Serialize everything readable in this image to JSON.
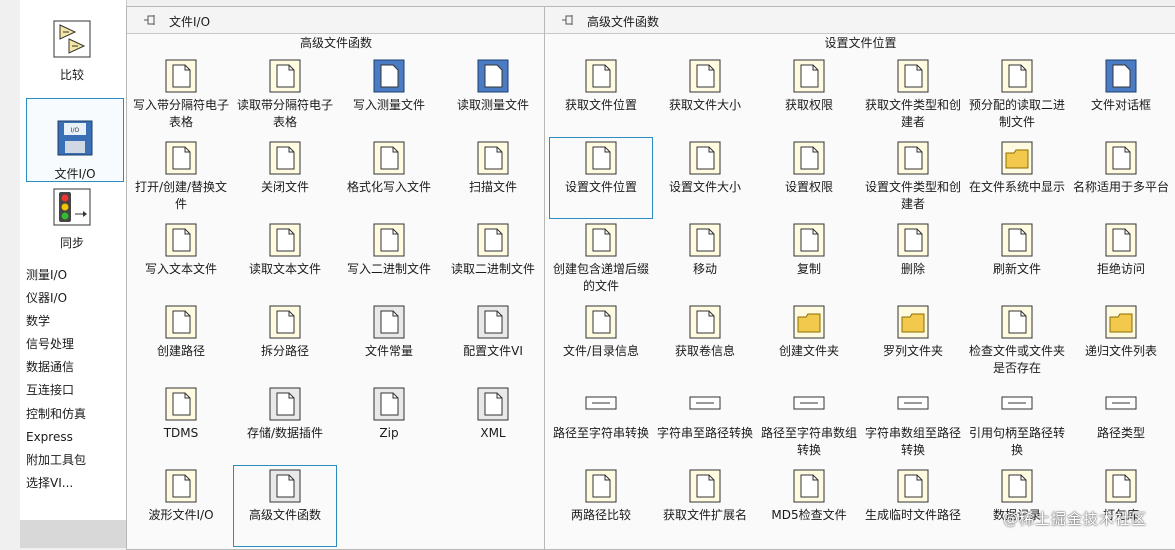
{
  "left": {
    "compare_label": "比较",
    "file_io_label": "文件I/O",
    "sync_label": "同步",
    "list": [
      "测量I/O",
      "仪器I/O",
      "数学",
      "信号处理",
      "数据通信",
      "互连接口",
      "控制和仿真",
      "Express",
      "附加工具包",
      "选择VI..."
    ]
  },
  "panel1": {
    "title": "文件I/O",
    "subtitle": "高级文件函数",
    "items": [
      {
        "label": "写入带分隔符电子表格",
        "icon": "spreadsheet-write-icon"
      },
      {
        "label": "读取带分隔符电子表格",
        "icon": "spreadsheet-read-icon"
      },
      {
        "label": "写入测量文件",
        "icon": "write-measurement-file-icon"
      },
      {
        "label": "读取测量文件",
        "icon": "read-measurement-file-icon"
      },
      {
        "label": "打开/创建/替换文件",
        "icon": "open-file-icon"
      },
      {
        "label": "关闭文件",
        "icon": "close-file-icon"
      },
      {
        "label": "格式化写入文件",
        "icon": "format-into-file-icon"
      },
      {
        "label": "扫描文件",
        "icon": "scan-from-file-icon"
      },
      {
        "label": "写入文本文件",
        "icon": "write-text-file-icon"
      },
      {
        "label": "读取文本文件",
        "icon": "read-text-file-icon"
      },
      {
        "label": "写入二进制文件",
        "icon": "write-binary-file-icon"
      },
      {
        "label": "读取二进制文件",
        "icon": "read-binary-file-icon"
      },
      {
        "label": "创建路径",
        "icon": "build-path-icon"
      },
      {
        "label": "拆分路径",
        "icon": "strip-path-icon"
      },
      {
        "label": "文件常量",
        "icon": "file-constants-icon"
      },
      {
        "label": "配置文件VI",
        "icon": "config-file-icon"
      },
      {
        "label": "TDMS",
        "icon": "tdms-icon"
      },
      {
        "label": "存储/数据插件",
        "icon": "storage-plugin-icon"
      },
      {
        "label": "Zip",
        "icon": "zip-icon"
      },
      {
        "label": "XML",
        "icon": "xml-icon"
      },
      {
        "label": "波形文件I/O",
        "icon": "waveform-file-icon"
      },
      {
        "label": "高级文件函数",
        "icon": "advanced-file-functions-icon"
      }
    ]
  },
  "panel2": {
    "title": "高级文件函数",
    "subtitle": "设置文件位置",
    "items": [
      {
        "label": "获取文件位置",
        "icon": "get-file-position-icon"
      },
      {
        "label": "获取文件大小",
        "icon": "get-file-size-icon"
      },
      {
        "label": "获取权限",
        "icon": "get-permissions-icon"
      },
      {
        "label": "获取文件类型和创建者",
        "icon": "get-file-type-icon"
      },
      {
        "label": "预分配的读取二进制文件",
        "icon": "preallocated-read-icon"
      },
      {
        "label": "文件对话框",
        "icon": "file-dialog-icon"
      },
      {
        "label": "设置文件位置",
        "icon": "set-file-position-icon"
      },
      {
        "label": "设置文件大小",
        "icon": "set-file-size-icon"
      },
      {
        "label": "设置权限",
        "icon": "set-permissions-icon"
      },
      {
        "label": "设置文件类型和创建者",
        "icon": "set-file-type-icon"
      },
      {
        "label": "在文件系统中显示",
        "icon": "show-in-filesystem-icon"
      },
      {
        "label": "名称适用于多平台",
        "icon": "name-multiplatform-icon"
      },
      {
        "label": "创建包含递增后缀的文件",
        "icon": "create-incrementing-file-icon"
      },
      {
        "label": "移动",
        "icon": "move-icon"
      },
      {
        "label": "复制",
        "icon": "copy-icon"
      },
      {
        "label": "删除",
        "icon": "delete-icon"
      },
      {
        "label": "刷新文件",
        "icon": "flush-file-icon"
      },
      {
        "label": "拒绝访问",
        "icon": "deny-access-icon"
      },
      {
        "label": "文件/目录信息",
        "icon": "file-dir-info-icon"
      },
      {
        "label": "获取卷信息",
        "icon": "volume-info-icon"
      },
      {
        "label": "创建文件夹",
        "icon": "create-folder-icon"
      },
      {
        "label": "罗列文件夹",
        "icon": "list-folder-icon"
      },
      {
        "label": "检查文件或文件夹是否存在",
        "icon": "check-exists-icon"
      },
      {
        "label": "递归文件列表",
        "icon": "recursive-list-icon"
      },
      {
        "label": "路径至字符串转换",
        "icon": "path-to-string-icon"
      },
      {
        "label": "字符串至路径转换",
        "icon": "string-to-path-icon"
      },
      {
        "label": "路径至字符串数组转换",
        "icon": "path-to-string-array-icon"
      },
      {
        "label": "字符串数组至路径转换",
        "icon": "string-array-to-path-icon"
      },
      {
        "label": "引用句柄至路径转换",
        "icon": "refnum-to-path-icon"
      },
      {
        "label": "路径类型",
        "icon": "path-type-icon"
      },
      {
        "label": "两路径比较",
        "icon": "compare-paths-icon"
      },
      {
        "label": "获取文件扩展名",
        "icon": "get-file-extension-icon"
      },
      {
        "label": "MD5检查文件",
        "icon": "md5-checksum-icon"
      },
      {
        "label": "生成临时文件路径",
        "icon": "temp-file-path-icon"
      },
      {
        "label": "数据记录",
        "icon": "datalog-icon"
      },
      {
        "label": "打包库",
        "icon": "packed-library-icon"
      }
    ]
  },
  "watermark": "@稀土掘金技术社区"
}
